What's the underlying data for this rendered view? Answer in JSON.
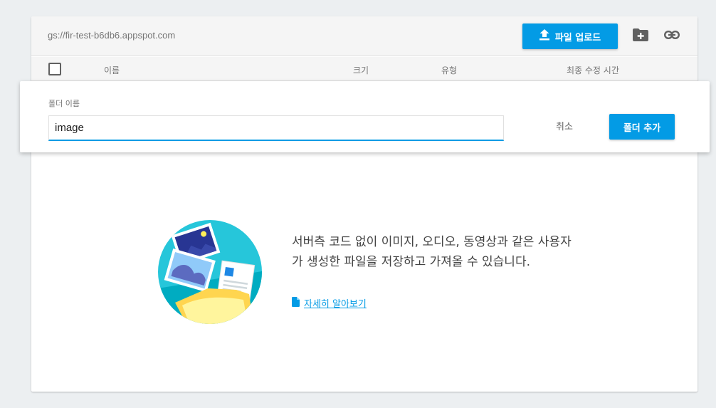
{
  "toolbar": {
    "bucket_path": "gs://fir-test-b6db6.appspot.com",
    "upload_label": "파일 업로드",
    "icons": {
      "upload": "upload-arrow-icon",
      "new_folder": "folder-plus-icon",
      "link": "link-icon"
    }
  },
  "table_header": {
    "name": "이름",
    "size": "크기",
    "type": "유형",
    "modified": "최종 수정 시간"
  },
  "dialog": {
    "label": "폴더 이름",
    "input_value": "image",
    "cancel_label": "취소",
    "add_label": "폴더 추가"
  },
  "empty_state": {
    "message": "서버측 코드 없이 이미지, 오디오, 동영상과 같은 사용자가 생성한 파일을 저장하고 가져올 수 있습니다.",
    "learn_more": "자세히 알아보기",
    "icons": {
      "learn_more": "document-icon",
      "illustration": "folder-photos-illustration"
    }
  },
  "colors": {
    "accent": "#039be5",
    "background": "#eceff1",
    "toolbar": "#f5f5f5"
  }
}
